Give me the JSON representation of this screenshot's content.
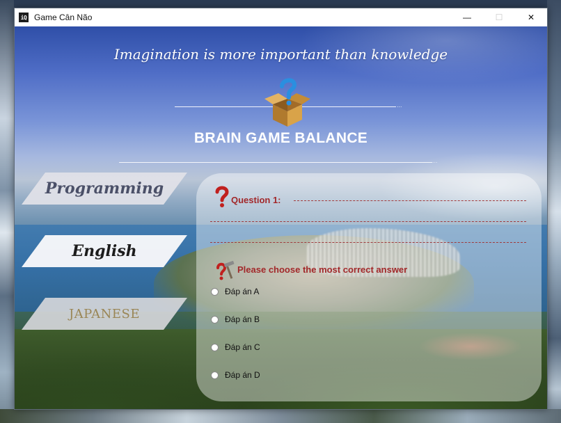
{
  "window": {
    "title": "Game Cân Não",
    "app_icon_text": "iQ",
    "controls": {
      "minimize": "—",
      "maximize": "☐",
      "close": "✕"
    }
  },
  "header": {
    "quote": "Imagination is more important than knowledge",
    "title": "BRAIN GAME BALANCE",
    "line_dots": "..."
  },
  "nav": {
    "programming": "Programming",
    "english": "English",
    "japanese": "JAPANESE"
  },
  "question": {
    "label": "Question 1:",
    "instruction": "Please choose the most correct answer",
    "options": [
      "Đáp án A",
      "Đáp án B",
      "Đáp án C",
      "Đáp án D"
    ]
  },
  "colors": {
    "accent_red": "#a2282a",
    "title_white": "#ffffff"
  }
}
